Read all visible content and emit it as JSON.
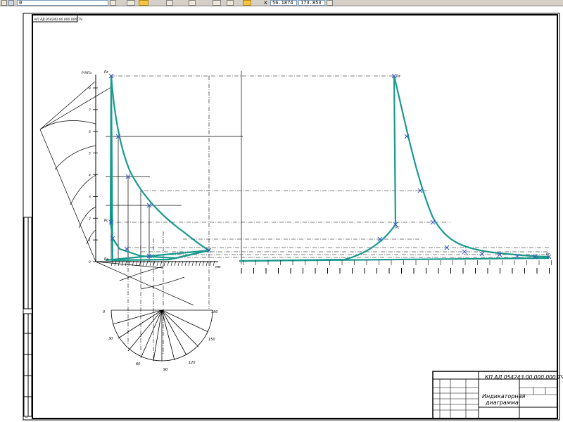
{
  "toolbar": {
    "layer_value": "0",
    "coord_x_label": "x",
    "coord_x_value": "56.1874",
    "coord_y_value": "173.853"
  },
  "sheet": {
    "top_stamp": "КП АД 054243.00.000.000 ТЧ",
    "title_block": {
      "designation": "КП АД 054243.00.000.000 ТЧ",
      "name_line1": "Индикаторная",
      "name_line2": "диаграмма"
    }
  },
  "diagram": {
    "p_axis_title": "P МПа",
    "p_ticks": [
      "8",
      "7",
      "6",
      "5",
      "4",
      "3",
      "2",
      "1",
      "0"
    ],
    "point_labels": {
      "pz_left": "Pz",
      "pz_right": "Pz",
      "pc_left": "Pc",
      "pc_right": "Pc",
      "pa": "Pa",
      "pr": "Pr"
    },
    "angle_labels": [
      "0",
      "30",
      "60",
      "90",
      "120",
      "150",
      "180"
    ],
    "s_unit": "мм",
    "colors": {
      "curve": "#1a9a8e",
      "line": "#000000",
      "frame": "#000000"
    }
  }
}
